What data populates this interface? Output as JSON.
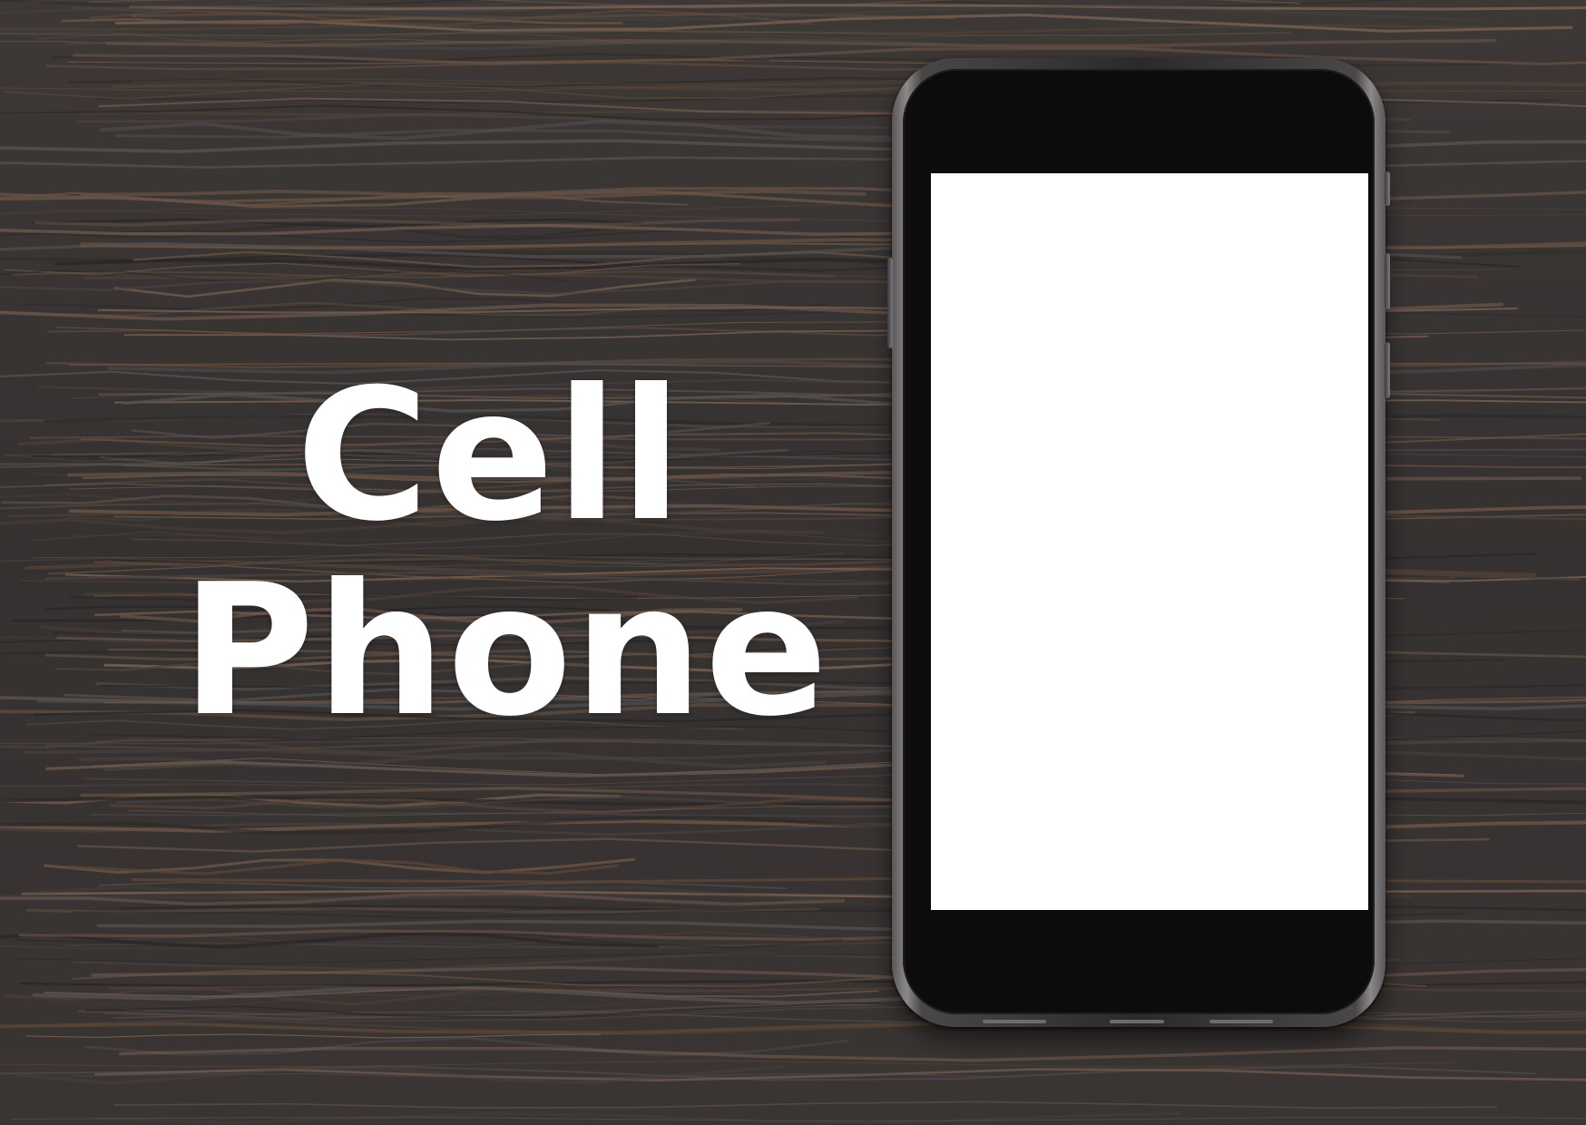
{
  "headline": {
    "line1": "Cell",
    "line2": "Phone"
  },
  "colors": {
    "wood_dark": "#2e2b2a",
    "wood_light": "#6b5446",
    "phone_body": "#2b292a",
    "screen": "#ffffff",
    "text": "#ffffff"
  }
}
